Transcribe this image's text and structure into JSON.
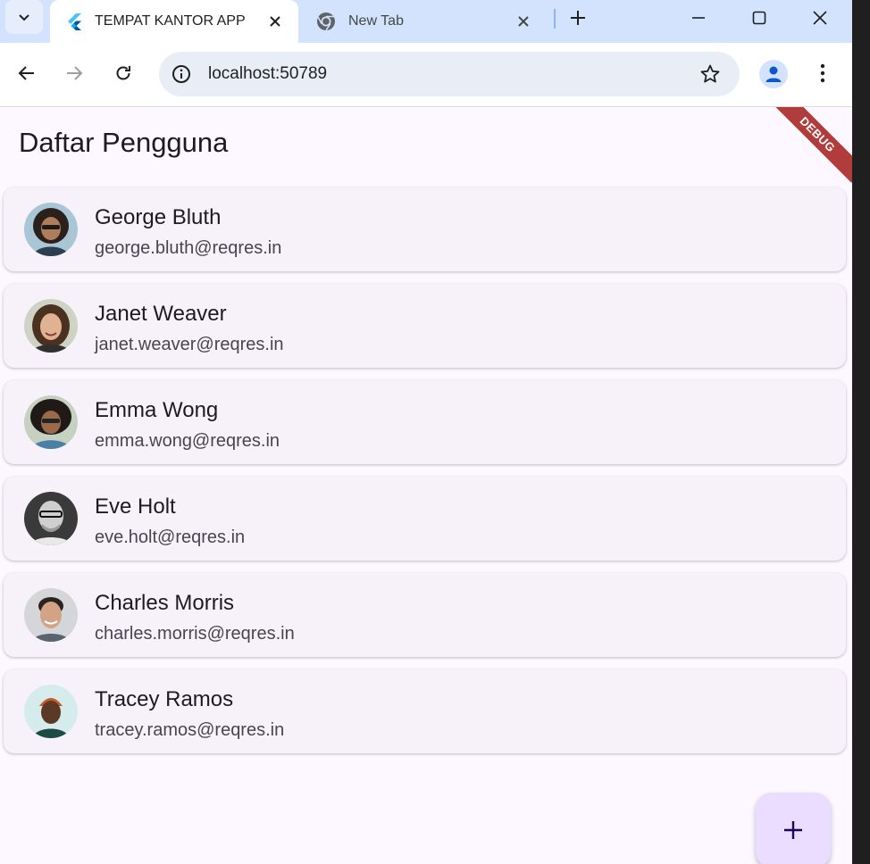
{
  "browser": {
    "tabs": [
      {
        "title": "TEMPAT KANTOR APP",
        "icon": "flutter-icon",
        "active": true
      },
      {
        "title": "New Tab",
        "icon": "chrome-icon",
        "active": false
      }
    ],
    "url": "localhost:50789"
  },
  "app": {
    "title": "Daftar Pengguna",
    "debug_label": "DEBUG",
    "accent": "#eaddff",
    "users": [
      {
        "name": "George Bluth",
        "email": "george.bluth@reqres.in"
      },
      {
        "name": "Janet Weaver",
        "email": "janet.weaver@reqres.in"
      },
      {
        "name": "Emma Wong",
        "email": "emma.wong@reqres.in"
      },
      {
        "name": "Eve Holt",
        "email": "eve.holt@reqres.in"
      },
      {
        "name": "Charles Morris",
        "email": "charles.morris@reqres.in"
      },
      {
        "name": "Tracey Ramos",
        "email": "tracey.ramos@reqres.in"
      }
    ],
    "fab_icon": "plus-icon"
  }
}
